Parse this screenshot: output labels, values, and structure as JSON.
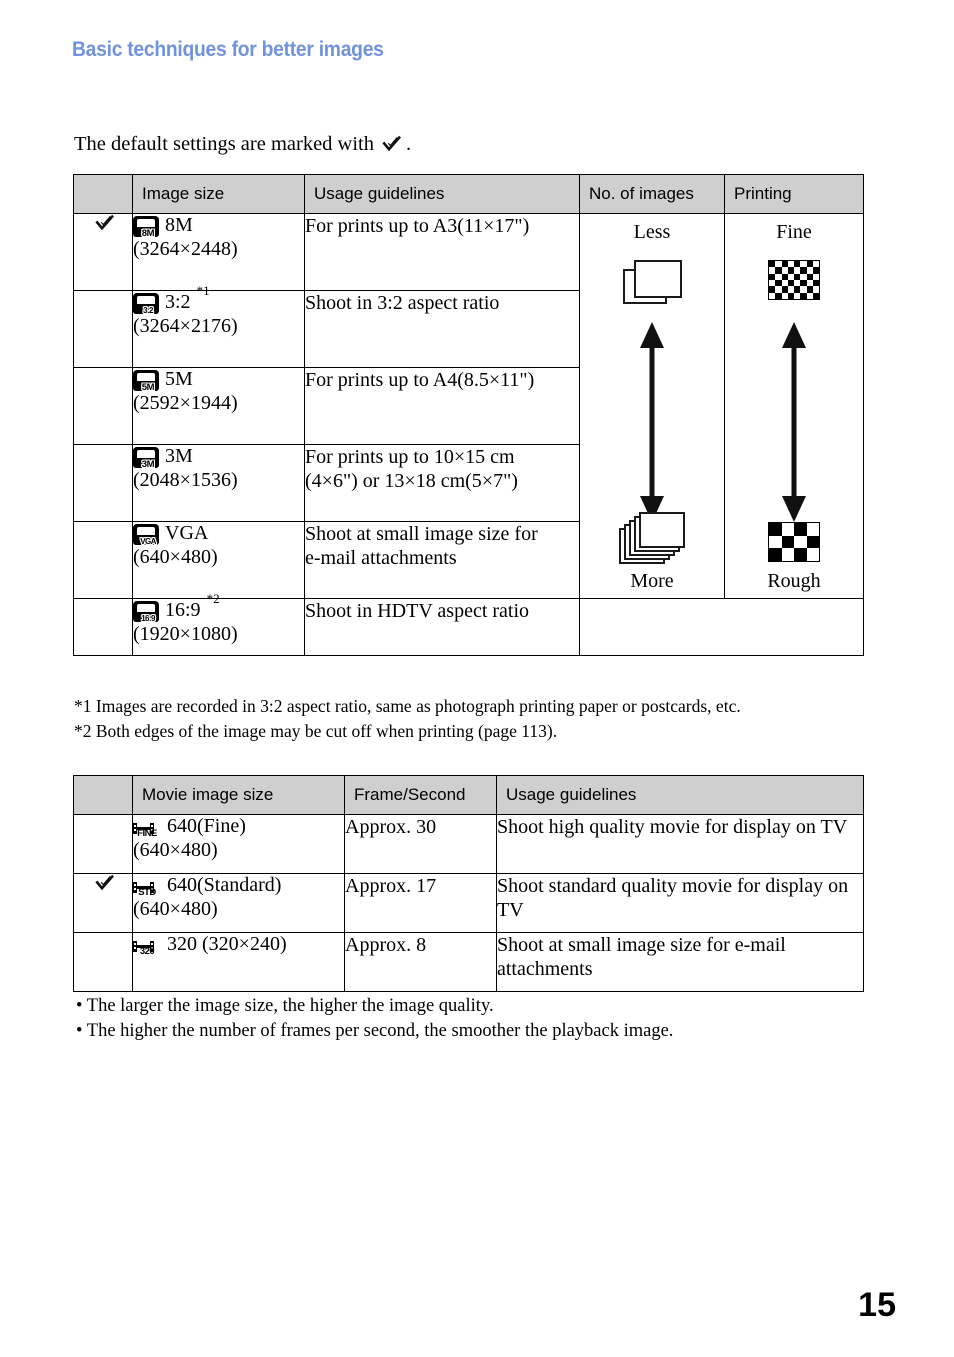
{
  "header": {
    "title": "Basic techniques for better images",
    "title_color": "#7192dd"
  },
  "intro": {
    "text_before": "The default settings are marked with",
    "text_after": ".",
    "icon": "checkmark-icon"
  },
  "table_still": {
    "columns": [
      "",
      "Image size",
      "Usage guidelines",
      "No. of images",
      "Printing"
    ],
    "rows": [
      {
        "default": true,
        "icon_label": "8M",
        "size_name": "8M",
        "footnote": "",
        "resolution": "(3264×2448)",
        "usage": [
          "For prints up to A3(11×17\")"
        ]
      },
      {
        "default": false,
        "icon_label": "3:2",
        "size_name": "3:2",
        "footnote": "*1",
        "resolution": "(3264×2176)",
        "usage": [
          "Shoot in 3:2 aspect ratio"
        ]
      },
      {
        "default": false,
        "icon_label": "5M",
        "size_name": "5M",
        "footnote": "",
        "resolution": "(2592×1944)",
        "usage": [
          "For prints up to A4(8.5×11\")"
        ]
      },
      {
        "default": false,
        "icon_label": "3M",
        "size_name": "3M",
        "footnote": "",
        "resolution": "(2048×1536)",
        "usage": [
          "For prints up to 10×15 cm",
          "(4×6\") or 13×18 cm(5×7\")"
        ]
      },
      {
        "default": false,
        "icon_label": "VGA",
        "size_name": "VGA",
        "footnote": "",
        "resolution": "(640×480)",
        "usage": [
          "Shoot at small image size for",
          "e-mail attachments"
        ]
      },
      {
        "default": false,
        "icon_label": "16:9",
        "size_name": "16:9",
        "footnote": "*2",
        "resolution": "(1920×1080)",
        "usage": [
          "Shoot in HDTV aspect ratio"
        ]
      }
    ],
    "num_images_scale": {
      "top_label": "Less",
      "bottom_label": "More",
      "top_icon": "single-paper-icon",
      "bottom_icon": "paper-stack-icon",
      "arrow": "double-headed-vertical-arrow"
    },
    "printing_scale": {
      "top_label": "Fine",
      "bottom_label": "Rough",
      "top_icon": "fine-checkerboard-icon",
      "bottom_icon": "rough-checkerboard-icon",
      "arrow": "double-headed-vertical-arrow"
    }
  },
  "footnotes": [
    "*1  Images are recorded in 3:2 aspect ratio, same as photograph printing paper or postcards, etc.",
    "*2  Both edges of the image may be cut off when printing (page 113)."
  ],
  "table_movie": {
    "columns": [
      "",
      "Movie image size",
      "Frame/Second",
      "Usage guidelines"
    ],
    "rows": [
      {
        "default": false,
        "icon_label": "FINE",
        "size_name": "640(Fine)",
        "resolution": "(640×480)",
        "fps": "Approx. 30",
        "usage": [
          "Shoot high quality movie for display on TV"
        ]
      },
      {
        "default": true,
        "icon_label": "STD",
        "size_name": "640(Standard)",
        "resolution": "(640×480)",
        "fps": "Approx. 17",
        "usage": [
          "Shoot standard quality movie for display on",
          "TV"
        ]
      },
      {
        "default": false,
        "icon_label": "320",
        "size_name": "320 (320×240)",
        "resolution": "",
        "fps": "Approx. 8",
        "usage": [
          "Shoot at small image size for e-mail",
          "attachments"
        ]
      }
    ]
  },
  "bullets": [
    "• The larger the image size, the higher the image quality.",
    "• The higher the number of frames per second, the smoother the playback image."
  ],
  "page_number": "15"
}
